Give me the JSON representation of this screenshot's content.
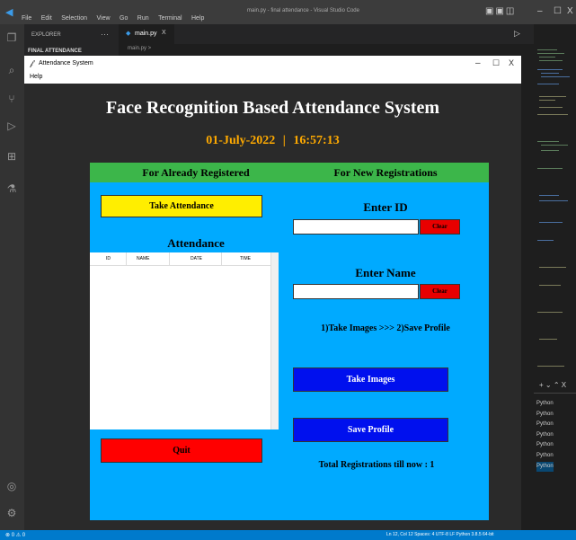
{
  "vscode": {
    "title": "main.py - final attendance - Visual Studio Code",
    "menu": [
      "File",
      "Edit",
      "Selection",
      "View",
      "Go",
      "Run",
      "Terminal",
      "Help"
    ],
    "explorer_label": "EXPLORER",
    "folder_label": "FINAL ATTENDANCE",
    "tab_label": "main.py",
    "tab_close": "X",
    "breadcrumb": "main.py >",
    "terminal_items": [
      "Python",
      "Python",
      "Python",
      "Python",
      "Python",
      "Python",
      "Python"
    ],
    "terminal_toolbar": "+ ⌄ ⌃ X",
    "status_left": "⊗ 0 ⚠ 0",
    "status_right": "Ln 12, Col 12   Spaces: 4   UTF-8   LF   Python   3.8.5 64-bit"
  },
  "tk": {
    "title": "Attendance System",
    "menu_help": "Help",
    "win_minimize": "–",
    "win_maximize": "☐",
    "win_close": "X",
    "heading": "Face Recognition Based Attendance System",
    "date": "01-July-2022",
    "separator": "|",
    "time": "16:57:13",
    "left": {
      "header": "For Already Registered",
      "take_attendance": "Take Attendance",
      "attendance_label": "Attendance",
      "columns": [
        "ID",
        "NAME",
        "DATE",
        "TIME"
      ],
      "quit": "Quit"
    },
    "right": {
      "header": "For New Registrations",
      "enter_id": "Enter ID",
      "id_value": "",
      "clear1": "Clear",
      "enter_name": "Enter Name",
      "name_value": "",
      "clear2": "Clear",
      "instructions": "1)Take Images  >>>  2)Save Profile",
      "take_images": "Take Images",
      "save_profile": "Save Profile",
      "total": "Total Registrations till now  : 1"
    }
  },
  "colors": {
    "panel_bg": "#00aaff",
    "panel_header": "#3cb64a",
    "take_attendance": "#ffee00",
    "quit": "#ff0000",
    "clear": "#e80000",
    "blue_button": "#0010ee",
    "date_color": "#ffaa00",
    "content_bg": "#2a2a2a"
  }
}
